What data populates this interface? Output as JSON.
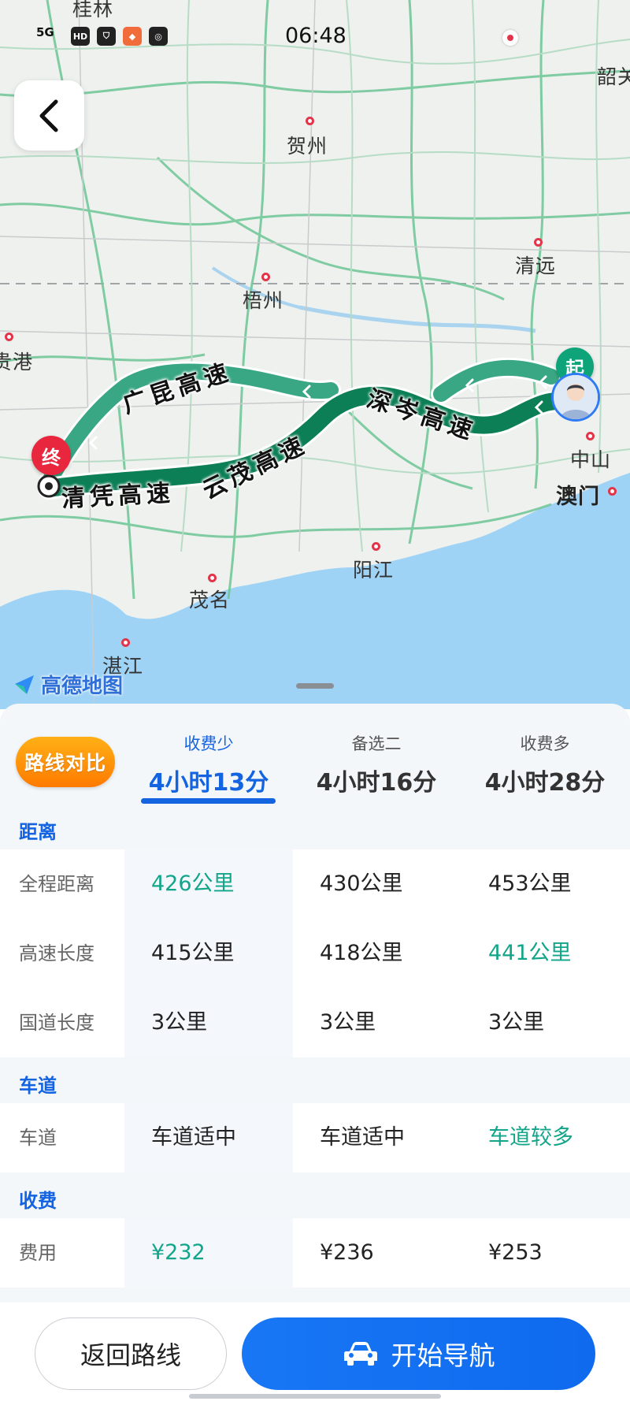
{
  "status_bar": {
    "network": "5G",
    "icons": [
      "HD",
      "shield",
      "app",
      "ai"
    ],
    "time": "06:48"
  },
  "map": {
    "cities": [
      {
        "name": "桂林"
      },
      {
        "name": "贺州"
      },
      {
        "name": "韶关"
      },
      {
        "name": "清远"
      },
      {
        "name": "梧州"
      },
      {
        "name": "贵港"
      },
      {
        "name": "中山"
      },
      {
        "name": "澳门"
      },
      {
        "name": "阳江"
      },
      {
        "name": "茂名"
      },
      {
        "name": "湛江"
      }
    ],
    "road_labels": [
      "广昆高速",
      "深岑高速",
      "云茂高速",
      "清凭高速"
    ],
    "start_marker": "起",
    "end_marker": "终",
    "logo": "高德地图"
  },
  "panel": {
    "badge": "路线对比",
    "routes": [
      {
        "tag": "收费少",
        "duration": "4小时13分",
        "active": true
      },
      {
        "tag": "备选二",
        "duration": "4小时16分",
        "active": false
      },
      {
        "tag": "收费多",
        "duration": "4小时28分",
        "active": false
      }
    ],
    "sections": [
      {
        "title": "距离",
        "rows": [
          {
            "label": "全程距离",
            "values": [
              "426公里",
              "430公里",
              "453公里"
            ],
            "highlight": [
              true,
              false,
              false
            ]
          },
          {
            "label": "高速长度",
            "values": [
              "415公里",
              "418公里",
              "441公里"
            ],
            "highlight": [
              false,
              false,
              true
            ]
          },
          {
            "label": "国道长度",
            "values": [
              "3公里",
              "3公里",
              "3公里"
            ],
            "highlight": [
              false,
              false,
              false
            ]
          }
        ]
      },
      {
        "title": "车道",
        "rows": [
          {
            "label": "车道",
            "values": [
              "车道适中",
              "车道适中",
              "车道较多"
            ],
            "highlight": [
              false,
              false,
              true
            ]
          }
        ]
      },
      {
        "title": "收费",
        "rows": [
          {
            "label": "费用",
            "values": [
              "¥232",
              "¥236",
              "¥253"
            ],
            "highlight": [
              true,
              false,
              false
            ]
          }
        ]
      }
    ]
  },
  "buttons": {
    "return_label": "返回路线",
    "navigate_label": "开始导航"
  },
  "colors": {
    "accent": "#1463e0",
    "highlight_green": "#12a58a",
    "route_primary": "#0c7f56",
    "route_secondary": "#3aa784",
    "badge_orange": "#ff9500"
  }
}
